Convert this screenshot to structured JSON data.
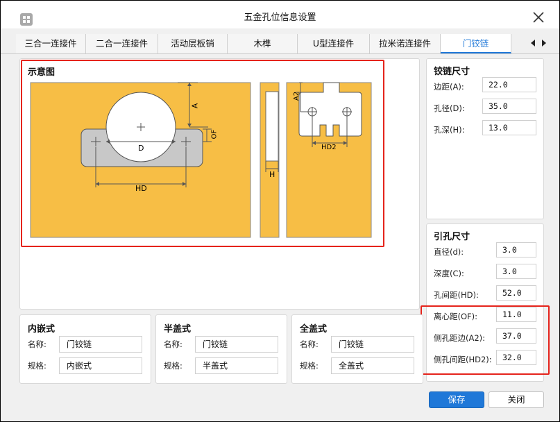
{
  "window": {
    "title": "五金孔位信息设置"
  },
  "tabs": [
    {
      "label": "三合一连接件"
    },
    {
      "label": "二合一连接件"
    },
    {
      "label": "活动层板销"
    },
    {
      "label": "木榫"
    },
    {
      "label": "U型连接件"
    },
    {
      "label": "拉米诺连接件"
    },
    {
      "label": "门铰链"
    }
  ],
  "diagram": {
    "title": "示意图",
    "labels": {
      "a": "A",
      "of": "OF",
      "d": "D",
      "hd": "HD",
      "h": "H",
      "a2": "A2",
      "hd2": "HD2"
    },
    "colors": {
      "board": "#f7be45",
      "hinge": "#c8c8c8",
      "red": "#e5231b"
    }
  },
  "hinge_size": {
    "title": "铰链尺寸",
    "fields": [
      {
        "label": "边距(A):",
        "value": "22.0"
      },
      {
        "label": "孔径(D):",
        "value": "35.0"
      },
      {
        "label": "孔深(H):",
        "value": "13.0"
      }
    ]
  },
  "pilot_hole": {
    "title": "引孔尺寸",
    "fields": [
      {
        "label": "直径(d):",
        "value": "3.0"
      },
      {
        "label": "深度(C):",
        "value": "3.0"
      },
      {
        "label": "孔间距(HD):",
        "value": "52.0"
      },
      {
        "label": "离心距(OF):",
        "value": "11.0"
      },
      {
        "label": "侧孔距边(A2):",
        "value": "37.0"
      },
      {
        "label": "侧孔间距(HD2):",
        "value": "32.0"
      }
    ]
  },
  "types": [
    {
      "title": "内嵌式",
      "name_label": "名称:",
      "name_value": "门铰链",
      "spec_label": "规格:",
      "spec_value": "内嵌式"
    },
    {
      "title": "半盖式",
      "name_label": "名称:",
      "name_value": "门铰链",
      "spec_label": "规格:",
      "spec_value": "半盖式"
    },
    {
      "title": "全盖式",
      "name_label": "名称:",
      "name_value": "门铰链",
      "spec_label": "规格:",
      "spec_value": "全盖式"
    }
  ],
  "buttons": {
    "save": "保存",
    "close": "关闭"
  },
  "colors": {
    "accent": "#1f78d8",
    "highlight_red": "#e5231b"
  }
}
